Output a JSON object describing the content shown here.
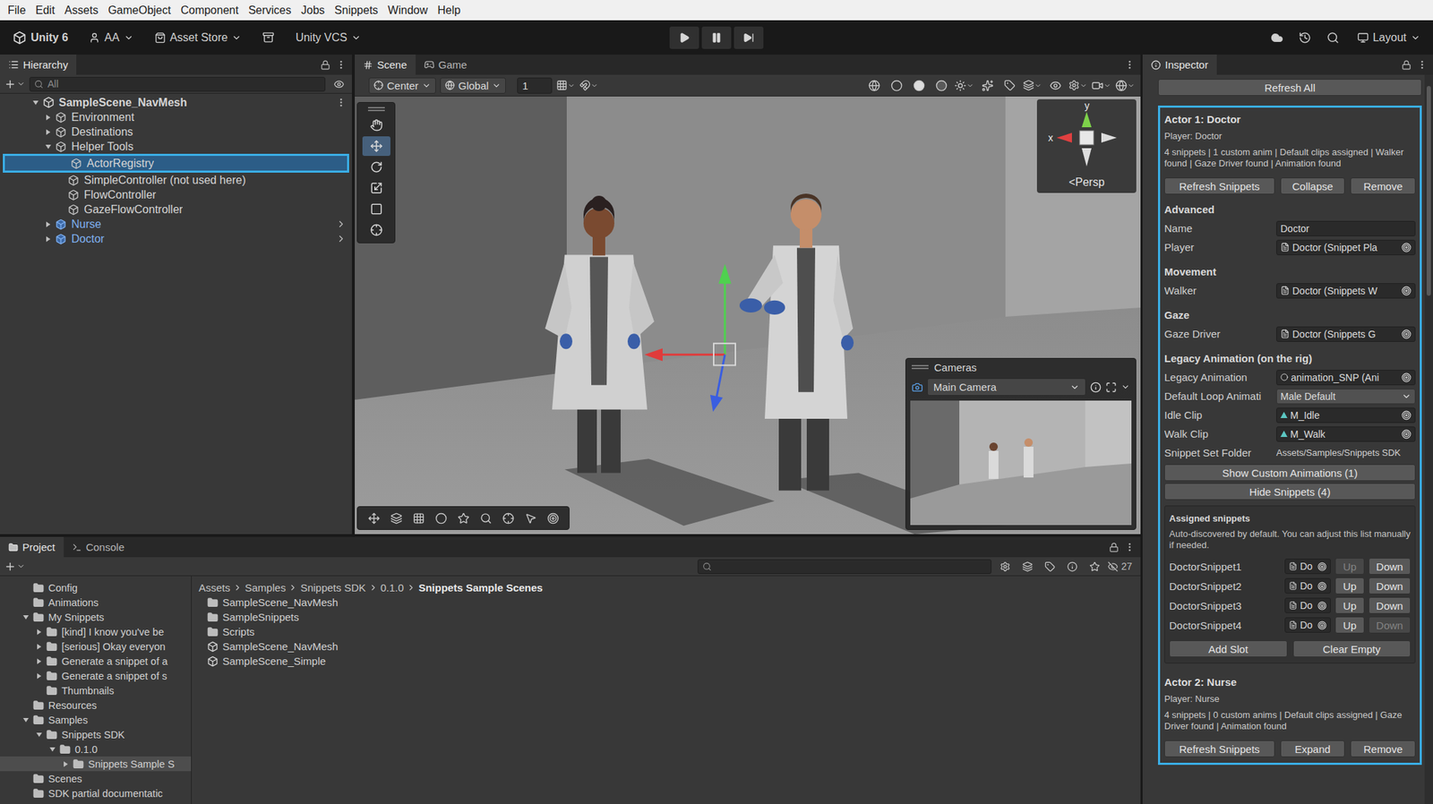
{
  "menu": [
    "File",
    "Edit",
    "Assets",
    "GameObject",
    "Component",
    "Services",
    "Jobs",
    "Snippets",
    "Window",
    "Help"
  ],
  "toolbar": {
    "product": "Unity 6",
    "account": "AA",
    "store": "Asset Store",
    "vcs": "Unity VCS",
    "layout": "Layout"
  },
  "hierarchy": {
    "tab": "Hierarchy",
    "search": "All",
    "items": [
      {
        "label": "SampleScene_NavMesh",
        "depth": 0,
        "kind": "scene",
        "expandable": true,
        "expanded": true,
        "selected": false,
        "highlighted": false
      },
      {
        "label": "Environment",
        "depth": 1,
        "kind": "object",
        "expandable": true,
        "expanded": false,
        "selected": false,
        "highlighted": false
      },
      {
        "label": "Destinations",
        "depth": 1,
        "kind": "object",
        "expandable": true,
        "expanded": false,
        "selected": false,
        "highlighted": false
      },
      {
        "label": "Helper Tools",
        "depth": 1,
        "kind": "object",
        "expandable": true,
        "expanded": true,
        "selected": false,
        "highlighted": false
      },
      {
        "label": "ActorRegistry",
        "depth": 2,
        "kind": "object",
        "expandable": false,
        "expanded": false,
        "selected": true,
        "highlighted": true
      },
      {
        "label": "SimpleController (not used here)",
        "depth": 2,
        "kind": "object",
        "expandable": false,
        "expanded": false,
        "selected": false,
        "highlighted": false
      },
      {
        "label": "FlowController",
        "depth": 2,
        "kind": "object",
        "expandable": false,
        "expanded": false,
        "selected": false,
        "highlighted": false
      },
      {
        "label": "GazeFlowController",
        "depth": 2,
        "kind": "object",
        "expandable": false,
        "expanded": false,
        "selected": false,
        "highlighted": false
      },
      {
        "label": "Nurse",
        "depth": 1,
        "kind": "prefab",
        "expandable": true,
        "expanded": false,
        "selected": false,
        "highlighted": false
      },
      {
        "label": "Doctor",
        "depth": 1,
        "kind": "prefab",
        "expandable": true,
        "expanded": false,
        "selected": false,
        "highlighted": false
      }
    ]
  },
  "scene": {
    "tabs": [
      {
        "label": "Scene",
        "selected": true
      },
      {
        "label": "Game",
        "selected": false
      }
    ],
    "pivot": "Center",
    "space": "Global",
    "grid": "1",
    "axis_y": "y",
    "axis_x": "x",
    "view": "<Persp",
    "cameras": {
      "title": "Cameras",
      "camera": "Main Camera"
    }
  },
  "project": {
    "tabs": [
      {
        "label": "Project",
        "selected": true
      },
      {
        "label": "Console",
        "selected": false
      }
    ],
    "count": "27",
    "tree": [
      {
        "label": "Config",
        "depth": 1,
        "expandable": false,
        "expanded": false,
        "selected": false
      },
      {
        "label": "Animations",
        "depth": 1,
        "expandable": false,
        "expanded": false,
        "selected": false
      },
      {
        "label": "My Snippets",
        "depth": 1,
        "expandable": true,
        "expanded": true,
        "selected": false
      },
      {
        "label": "[kind] I know you've be",
        "depth": 2,
        "expandable": true,
        "expanded": false,
        "selected": false
      },
      {
        "label": "[serious] Okay everyon",
        "depth": 2,
        "expandable": true,
        "expanded": false,
        "selected": false
      },
      {
        "label": "Generate a snippet of a",
        "depth": 2,
        "expandable": true,
        "expanded": false,
        "selected": false
      },
      {
        "label": "Generate a snippet of s",
        "depth": 2,
        "expandable": true,
        "expanded": false,
        "selected": false
      },
      {
        "label": "Thumbnails",
        "depth": 2,
        "expandable": false,
        "expanded": false,
        "selected": false
      },
      {
        "label": "Resources",
        "depth": 1,
        "expandable": false,
        "expanded": false,
        "selected": false
      },
      {
        "label": "Samples",
        "depth": 1,
        "expandable": true,
        "expanded": true,
        "selected": false
      },
      {
        "label": "Snippets SDK",
        "depth": 2,
        "expandable": true,
        "expanded": true,
        "selected": false
      },
      {
        "label": "0.1.0",
        "depth": 3,
        "expandable": true,
        "expanded": true,
        "selected": false
      },
      {
        "label": "Snippets Sample S",
        "depth": 4,
        "expandable": true,
        "expanded": false,
        "selected": true
      },
      {
        "label": "Scenes",
        "depth": 1,
        "expandable": false,
        "expanded": false,
        "selected": false
      },
      {
        "label": "SDK partial documentatic",
        "depth": 1,
        "expandable": false,
        "expanded": false,
        "selected": false
      }
    ],
    "breadcrumb": [
      "Assets",
      "Samples",
      "Snippets SDK",
      "0.1.0",
      "Snippets Sample Scenes"
    ],
    "files": [
      {
        "label": "SampleScene_NavMesh",
        "kind": "folder"
      },
      {
        "label": "SampleSnippets",
        "kind": "folder"
      },
      {
        "label": "Scripts",
        "kind": "folder"
      },
      {
        "label": "SampleScene_NavMesh",
        "kind": "scene"
      },
      {
        "label": "SampleScene_Simple",
        "kind": "scene"
      }
    ]
  },
  "inspector": {
    "tab": "Inspector",
    "refresh_all": "Refresh All",
    "highlighted": true,
    "actors": [
      {
        "title": "Actor 1: Doctor",
        "player": "Player: Doctor",
        "summary": "4 snippets | 1 custom anim | Default clips assigned | Walker found | Gaze Driver found | Animation found",
        "buttons": [
          "Refresh Snippets",
          "Collapse",
          "Remove"
        ],
        "expanded": true,
        "sections": [
          {
            "heading": "Advanced",
            "fields": [
              {
                "label": "Name",
                "value": "Doctor",
                "kind": "text"
              },
              {
                "label": "Player",
                "value": "Doctor (Snippet Pla",
                "kind": "object"
              }
            ]
          },
          {
            "heading": "Movement",
            "fields": [
              {
                "label": "Walker",
                "value": "Doctor (Snippets W",
                "kind": "object"
              }
            ]
          },
          {
            "heading": "Gaze",
            "fields": [
              {
                "label": "Gaze Driver",
                "value": "Doctor (Snippets G",
                "kind": "object"
              }
            ]
          },
          {
            "heading": "Legacy Animation (on the rig)",
            "fields": [
              {
                "label": "Legacy Animation",
                "value": "animation_SNP (Ani",
                "kind": "component"
              },
              {
                "label": "Default Loop Animati",
                "value": "Male Default",
                "kind": "dropdown"
              },
              {
                "label": "Idle Clip",
                "value": "M_Idle",
                "kind": "clip"
              },
              {
                "label": "Walk Clip",
                "value": "M_Walk",
                "kind": "clip"
              },
              {
                "label": "Snippet Set Folder",
                "value": "Assets/Samples/Snippets SDK",
                "kind": "path"
              }
            ]
          }
        ],
        "toggles": [
          "Show Custom Animations (1)",
          "Hide Snippets (4)"
        ],
        "snippets": {
          "title": "Assigned snippets",
          "help": "Auto-discovered by default. You can adjust this list manually if needed.",
          "slots": [
            {
              "name": "DoctorSnippet1",
              "value": "Do",
              "up": "Up",
              "down": "Down",
              "up_disabled": true,
              "down_disabled": false
            },
            {
              "name": "DoctorSnippet2",
              "value": "Do",
              "up": "Up",
              "down": "Down",
              "up_disabled": false,
              "down_disabled": false
            },
            {
              "name": "DoctorSnippet3",
              "value": "Do",
              "up": "Up",
              "down": "Down",
              "up_disabled": false,
              "down_disabled": false
            },
            {
              "name": "DoctorSnippet4",
              "value": "Do",
              "up": "Up",
              "down": "Down",
              "up_disabled": false,
              "down_disabled": true
            }
          ],
          "buttons": [
            "Add Slot",
            "Clear Empty"
          ]
        }
      },
      {
        "title": "Actor 2: Nurse",
        "player": "Player: Nurse",
        "summary": "4 snippets | 0 custom anims | Default clips assigned | Gaze Driver found | Animation found",
        "buttons": [
          "Refresh Snippets",
          "Expand",
          "Remove"
        ],
        "expanded": false
      }
    ]
  }
}
